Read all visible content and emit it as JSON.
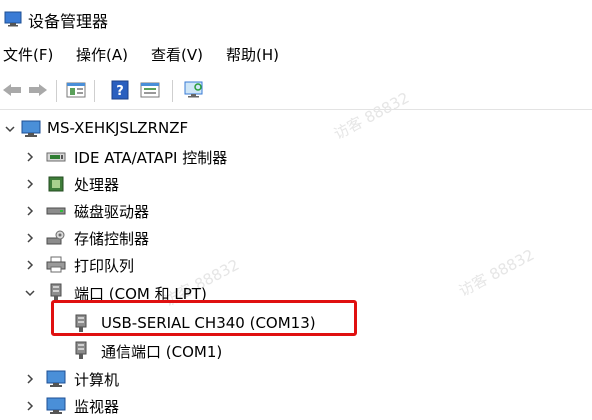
{
  "window": {
    "title": "设备管理器"
  },
  "menu": [
    "文件(F)",
    "操作(A)",
    "查看(V)",
    "帮助(H)"
  ],
  "toolbar": {
    "icons": [
      "back-arrow-icon",
      "forward-arrow-icon",
      "properties-icon",
      "help-icon",
      "view-icon",
      "monitor-scan-icon"
    ]
  },
  "tree": {
    "root": "MS-XEHKJSLZRNZF",
    "items": [
      {
        "label": "IDE ATA/ATAPI 控制器",
        "expanded": false,
        "icon": "ide-controller-icon"
      },
      {
        "label": "处理器",
        "expanded": false,
        "icon": "processor-icon"
      },
      {
        "label": "磁盘驱动器",
        "expanded": false,
        "icon": "disk-drive-icon"
      },
      {
        "label": "存储控制器",
        "expanded": false,
        "icon": "storage-controller-icon"
      },
      {
        "label": "打印队列",
        "expanded": false,
        "icon": "printer-icon"
      },
      {
        "label": "端口 (COM 和 LPT)",
        "expanded": true,
        "icon": "port-icon",
        "children": [
          {
            "label": "USB-SERIAL CH340 (COM13)",
            "highlighted": true,
            "icon": "port-icon"
          },
          {
            "label": "通信端口 (COM1)",
            "icon": "port-icon"
          }
        ]
      },
      {
        "label": "计算机",
        "expanded": false,
        "icon": "computer-icon"
      },
      {
        "label": "监视器",
        "expanded": false,
        "icon": "monitor-icon"
      }
    ]
  },
  "watermark": "访客 88832",
  "colors": {
    "highlight_border": "#e01010"
  }
}
